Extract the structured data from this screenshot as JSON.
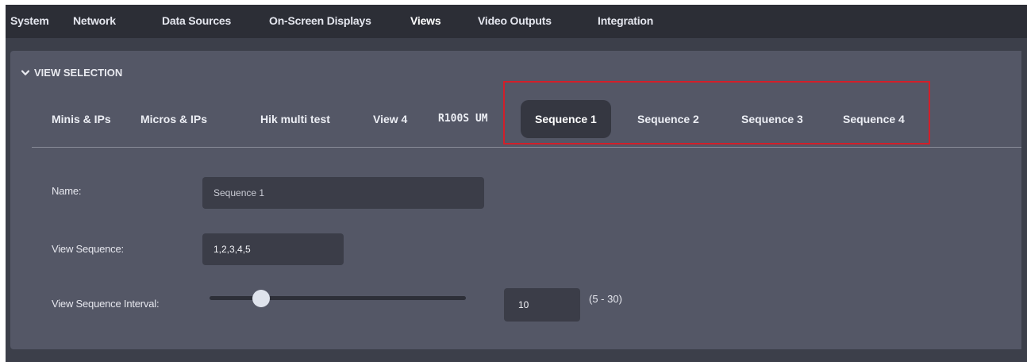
{
  "top_nav": {
    "tabs": [
      {
        "label": "System"
      },
      {
        "label": "Network"
      },
      {
        "label": "Data Sources"
      },
      {
        "label": "On-Screen Displays"
      },
      {
        "label": "Views"
      },
      {
        "label": "Video Outputs"
      },
      {
        "label": "Integration"
      }
    ],
    "active": "Views"
  },
  "section": {
    "title": "VIEW SELECTION",
    "icon": "chevron-down-icon"
  },
  "view_tabs": {
    "items": [
      {
        "label": "Minis & IPs"
      },
      {
        "label": "Micros & IPs"
      },
      {
        "label": "Hik multi test"
      },
      {
        "label": "View 4"
      },
      {
        "label": "R100S UM"
      },
      {
        "label": "Sequence 1"
      },
      {
        "label": "Sequence 2"
      },
      {
        "label": "Sequence 3"
      },
      {
        "label": "Sequence 4"
      }
    ],
    "active": "Sequence 1"
  },
  "form": {
    "name_label": "Name:",
    "name_value": "Sequence 1",
    "sequence_label": "View Sequence:",
    "sequence_value": "1,2,3,4,5",
    "interval_label": "View Sequence Interval:",
    "interval_value": "10",
    "interval_range_text": "(5 - 30)",
    "interval_min": 5,
    "interval_max": 30,
    "interval_slider_value": 10
  },
  "colors": {
    "background": "#3c3f4a",
    "top_nav": "#2c2e36",
    "panel": "#545766",
    "active_tab": "#353741",
    "highlight": "#d11f2a",
    "slider_thumb": "#dfe3ec"
  }
}
